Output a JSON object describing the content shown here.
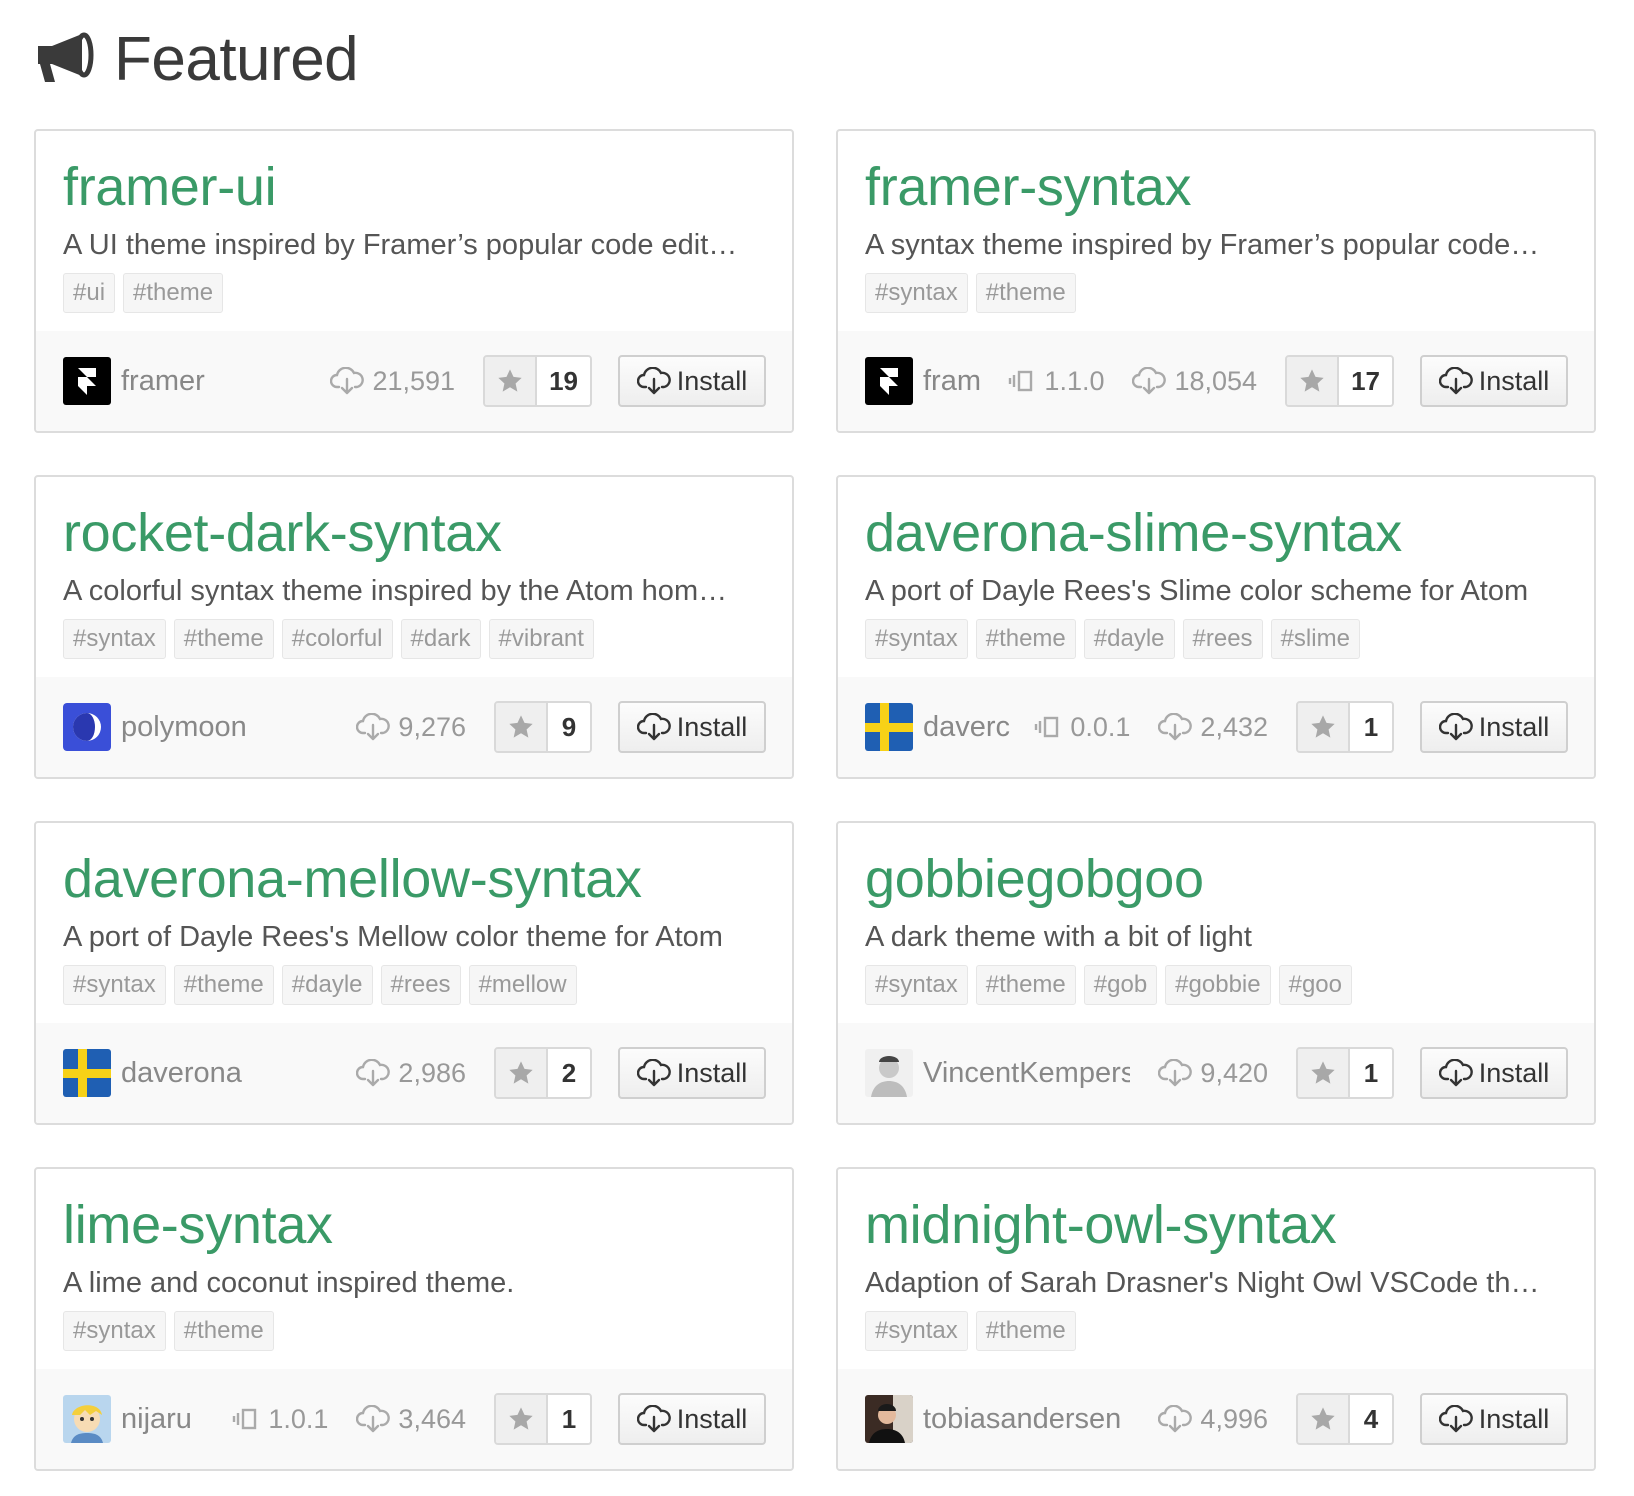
{
  "header": {
    "title": "Featured",
    "icon": "megaphone-icon"
  },
  "colors": {
    "package_name": "#3a9a67",
    "text": "#555555",
    "muted": "#999999"
  },
  "packages": [
    {
      "name": "framer-ui",
      "description": "A UI theme inspired by Framer’s popular code edit…",
      "tags": [
        "#ui",
        "#theme"
      ],
      "author": "framer",
      "avatar": "framer",
      "version": "",
      "downloads": "21,591",
      "stars": "19",
      "install_label": "Install"
    },
    {
      "name": "framer-syntax",
      "description": "A syntax theme inspired by Framer’s popular code…",
      "tags": [
        "#syntax",
        "#theme"
      ],
      "author": "fram",
      "avatar": "framer",
      "version": "1.1.0",
      "downloads": "18,054",
      "stars": "17",
      "install_label": "Install"
    },
    {
      "name": "rocket-dark-syntax",
      "description": "A colorful syntax theme inspired by the Atom hom…",
      "tags": [
        "#syntax",
        "#theme",
        "#colorful",
        "#dark",
        "#vibrant"
      ],
      "author": "polymoon",
      "avatar": "polymoon",
      "version": "",
      "downloads": "9,276",
      "stars": "9",
      "install_label": "Install"
    },
    {
      "name": "daverona-slime-syntax",
      "description": "A port of Dayle Rees's Slime color scheme for Atom",
      "tags": [
        "#syntax",
        "#theme",
        "#dayle",
        "#rees",
        "#slime"
      ],
      "author": "daverc",
      "avatar": "sweden",
      "version": "0.0.1",
      "downloads": "2,432",
      "stars": "1",
      "install_label": "Install"
    },
    {
      "name": "daverona-mellow-syntax",
      "description": "A port of Dayle Rees's Mellow color theme for Atom",
      "tags": [
        "#syntax",
        "#theme",
        "#dayle",
        "#rees",
        "#mellow"
      ],
      "author": "daverona",
      "avatar": "sweden",
      "version": "",
      "downloads": "2,986",
      "stars": "2",
      "install_label": "Install"
    },
    {
      "name": "gobbiegobgoo",
      "description": "A dark theme with a bit of light",
      "tags": [
        "#syntax",
        "#theme",
        "#gob",
        "#gobbie",
        "#goo"
      ],
      "author": "VincentKempers",
      "avatar": "person-light",
      "version": "",
      "downloads": "9,420",
      "stars": "1",
      "install_label": "Install"
    },
    {
      "name": "lime-syntax",
      "description": "A lime and coconut inspired theme.",
      "tags": [
        "#syntax",
        "#theme"
      ],
      "author": "nijaru",
      "avatar": "cartoon",
      "version": "1.0.1",
      "downloads": "3,464",
      "stars": "1",
      "install_label": "Install"
    },
    {
      "name": "midnight-owl-syntax",
      "description": "Adaption of Sarah Drasner's Night Owl VSCode th…",
      "tags": [
        "#syntax",
        "#theme"
      ],
      "author": "tobiasandersen",
      "avatar": "person-dark",
      "version": "",
      "downloads": "4,996",
      "stars": "4",
      "install_label": "Install"
    }
  ]
}
